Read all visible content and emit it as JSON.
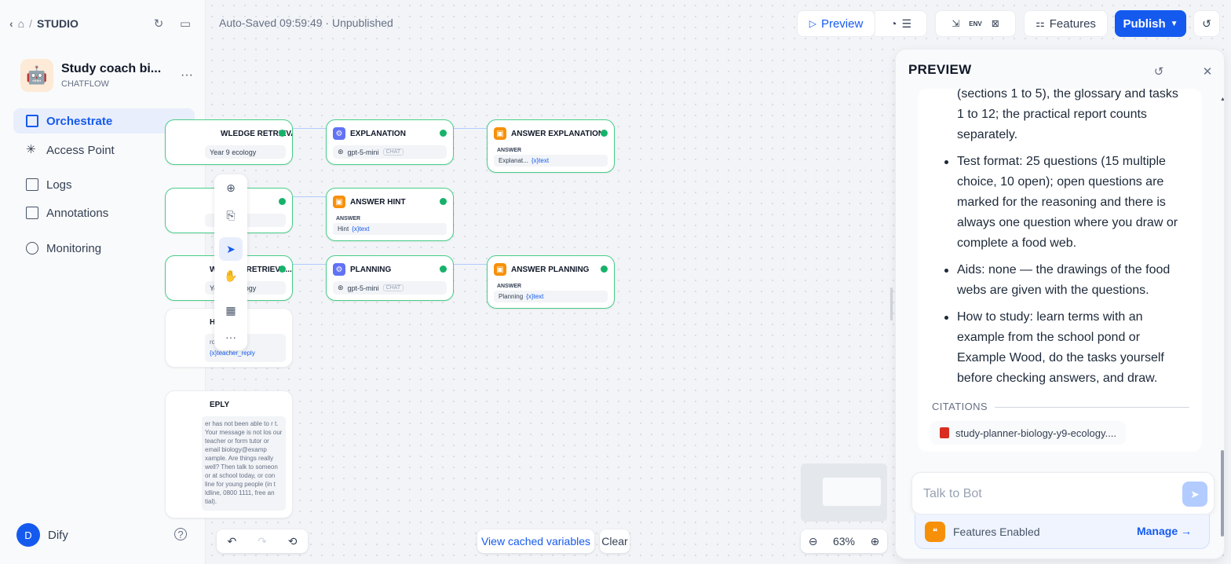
{
  "sidebar": {
    "breadcrumb": "STUDIO",
    "app_name": "Study coach bi...",
    "app_mode": "CHATFLOW",
    "nav": [
      "Orchestrate",
      "Access Point",
      "Logs",
      "Annotations",
      "Monitoring"
    ],
    "user": "Dify",
    "user_initial": "D"
  },
  "header": {
    "status": "Auto-Saved 09:59:49 · Unpublished",
    "preview": "Preview",
    "features": "Features",
    "publish": "Publish"
  },
  "nodes": {
    "knowledge1": {
      "title": "WLEDGE RETRIEVAL",
      "body": "Year 9 ecology"
    },
    "explanation": {
      "title": "EXPLANATION",
      "model": "gpt-5-mini",
      "tag": "CHAT"
    },
    "answer_explanation": {
      "title": "ANSWER EXPLANATION",
      "label": "ANSWER",
      "var": "Explanat...",
      "var_type": "{x}text"
    },
    "answer_hint": {
      "title": "ANSWER HINT",
      "label": "ANSWER",
      "var": "Hint",
      "var_type": "{x}text"
    },
    "knowledge2": {
      "title": "WLEDGE RETRIEVA...",
      "body": "Year 9 ecology"
    },
    "planning": {
      "title": "PLANNING",
      "model": "gpt-5-mini",
      "tag": "CHAT"
    },
    "answer_planning": {
      "title": "ANSWER PLANNING",
      "label": "ANSWER",
      "var": "Planning",
      "var_type": "{x}text"
    },
    "partial_hint": {
      "title": "H",
      "line1": "ro    cher:",
      "var": "{x}teacher_reply"
    },
    "reply": {
      "title": "EPLY",
      "body": "er has not been able to r t. Your message is not los our teacher or form tutor or email biology@examp xample. Are things really well? Then talk to someon or at school today, or con line for young people (in t ldline, 0800 1111, free an tial)."
    }
  },
  "canvas_footer": {
    "view_cached": "View cached variables",
    "clear": "Clear",
    "zoom": "63%"
  },
  "preview": {
    "title": "PREVIEW",
    "intro": "(sections 1 to 5), the glossary and tasks 1 to 12; the practical report counts separately.",
    "bullets": [
      "Test format: 25 questions (15 multiple choice, 10 open); open questions are marked for the reasoning and there is always one question where you draw or complete a food web.",
      "Aids: none — the drawings of the food webs are given with the questions.",
      "How to study: learn terms with an example from the school pond or Example Wood, do the tasks yourself before checking answers, and draw."
    ],
    "citations_label": "CITATIONS",
    "citation_file": "study-planner-biology-y9-ecology....",
    "input_placeholder": "Talk to Bot",
    "features_enabled": "Features Enabled",
    "manage": "Manage →"
  },
  "colors": {
    "accent": "#155aef",
    "success": "#17b26a",
    "node_border": "#47cd89"
  }
}
